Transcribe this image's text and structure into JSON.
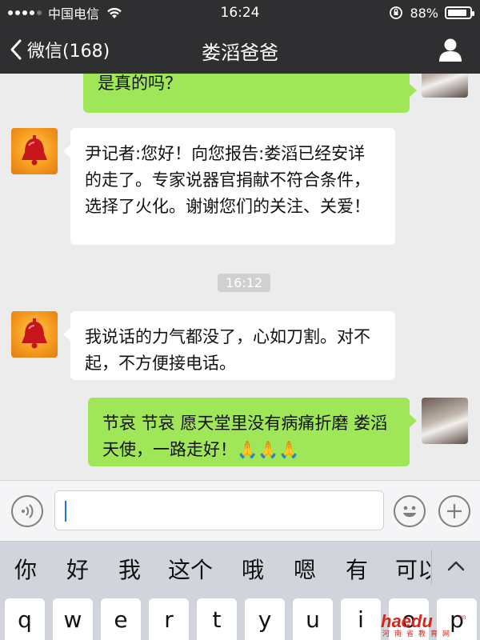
{
  "status_bar": {
    "carrier": "中国电信",
    "time": "16:24",
    "battery": "88%",
    "battery_level": 0.88
  },
  "nav": {
    "back_label": "微信(168)",
    "title": "娄滔爸爸"
  },
  "chat": {
    "messages": [
      {
        "side": "right",
        "text": "是真的吗？"
      },
      {
        "side": "left",
        "text": "尹记者:您好！向您报告:娄滔已经安详的走了。专家说器官捐献不符合条件，选择了火化。谢谢您们的关注、关爱！"
      },
      {
        "side": "left",
        "text": "我说话的力气都没了，心如刀割。对不起，不方便接电话。"
      },
      {
        "side": "right",
        "text": "节哀 节哀 愿天堂里没有病痛折磨 娄滔天使，一路走好！🙏🙏🙏"
      }
    ],
    "timestamp": "16:12"
  },
  "input_bar": {
    "voice_icon": "voice-icon",
    "emoji_icon": "emoji-icon",
    "plus_icon": "plus-icon",
    "value": ""
  },
  "keyboard": {
    "suggestions": [
      "你",
      "好",
      "我",
      "这个",
      "哦",
      "嗯",
      "有",
      "可以"
    ],
    "keys": [
      "q",
      "w",
      "e",
      "r",
      "t",
      "y",
      "u",
      "i",
      "o",
      "p"
    ]
  },
  "watermark": {
    "brand": "haedu",
    "subtitle": "河南省教育网",
    "suffix": "cn"
  },
  "colors": {
    "header": "#2f2f31",
    "bubble_self": "#9fe659",
    "bubble_other": "#ffffff",
    "watermark_red": "#d9251c"
  }
}
